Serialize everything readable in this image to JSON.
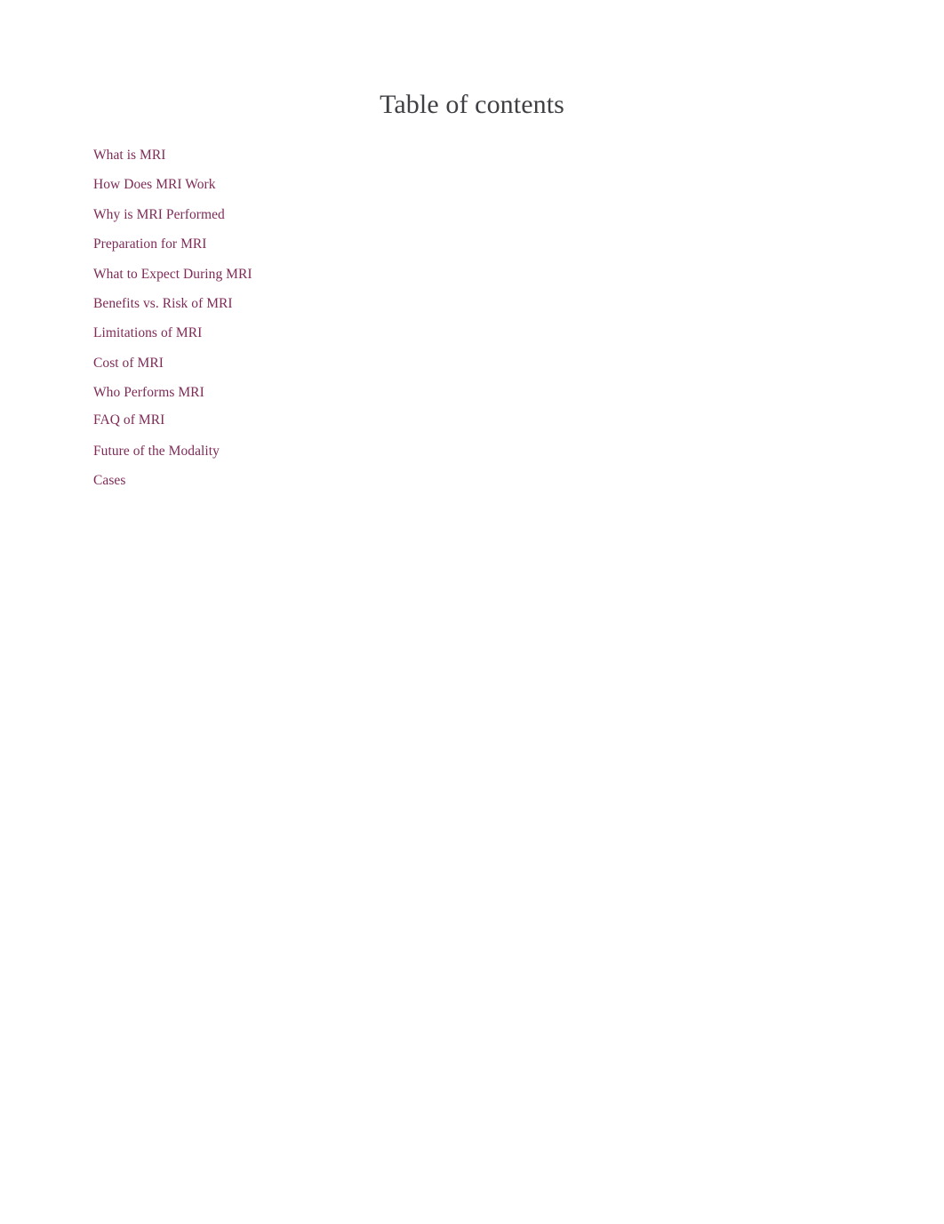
{
  "document": {
    "title": "Table of contents",
    "background_color": "#ffffff",
    "title_color": "#3f4044",
    "link_color": "#7e2b57"
  },
  "toc": {
    "heading": "Table of contents",
    "items": [
      {
        "label": "What is MRI"
      },
      {
        "label": "How Does MRI Work"
      },
      {
        "label": "Why is MRI Performed"
      },
      {
        "label": "Preparation for MRI"
      },
      {
        "label": "What to Expect During MRI"
      },
      {
        "label": "Benefits vs. Risk of MRI"
      },
      {
        "label": "Limitations of MRI"
      },
      {
        "label": "Cost of MRI"
      },
      {
        "label": "Who Performs MRI"
      },
      {
        "label": "FAQ of MRI"
      },
      {
        "label": "Future of the Modality"
      },
      {
        "label": "Cases"
      }
    ]
  }
}
